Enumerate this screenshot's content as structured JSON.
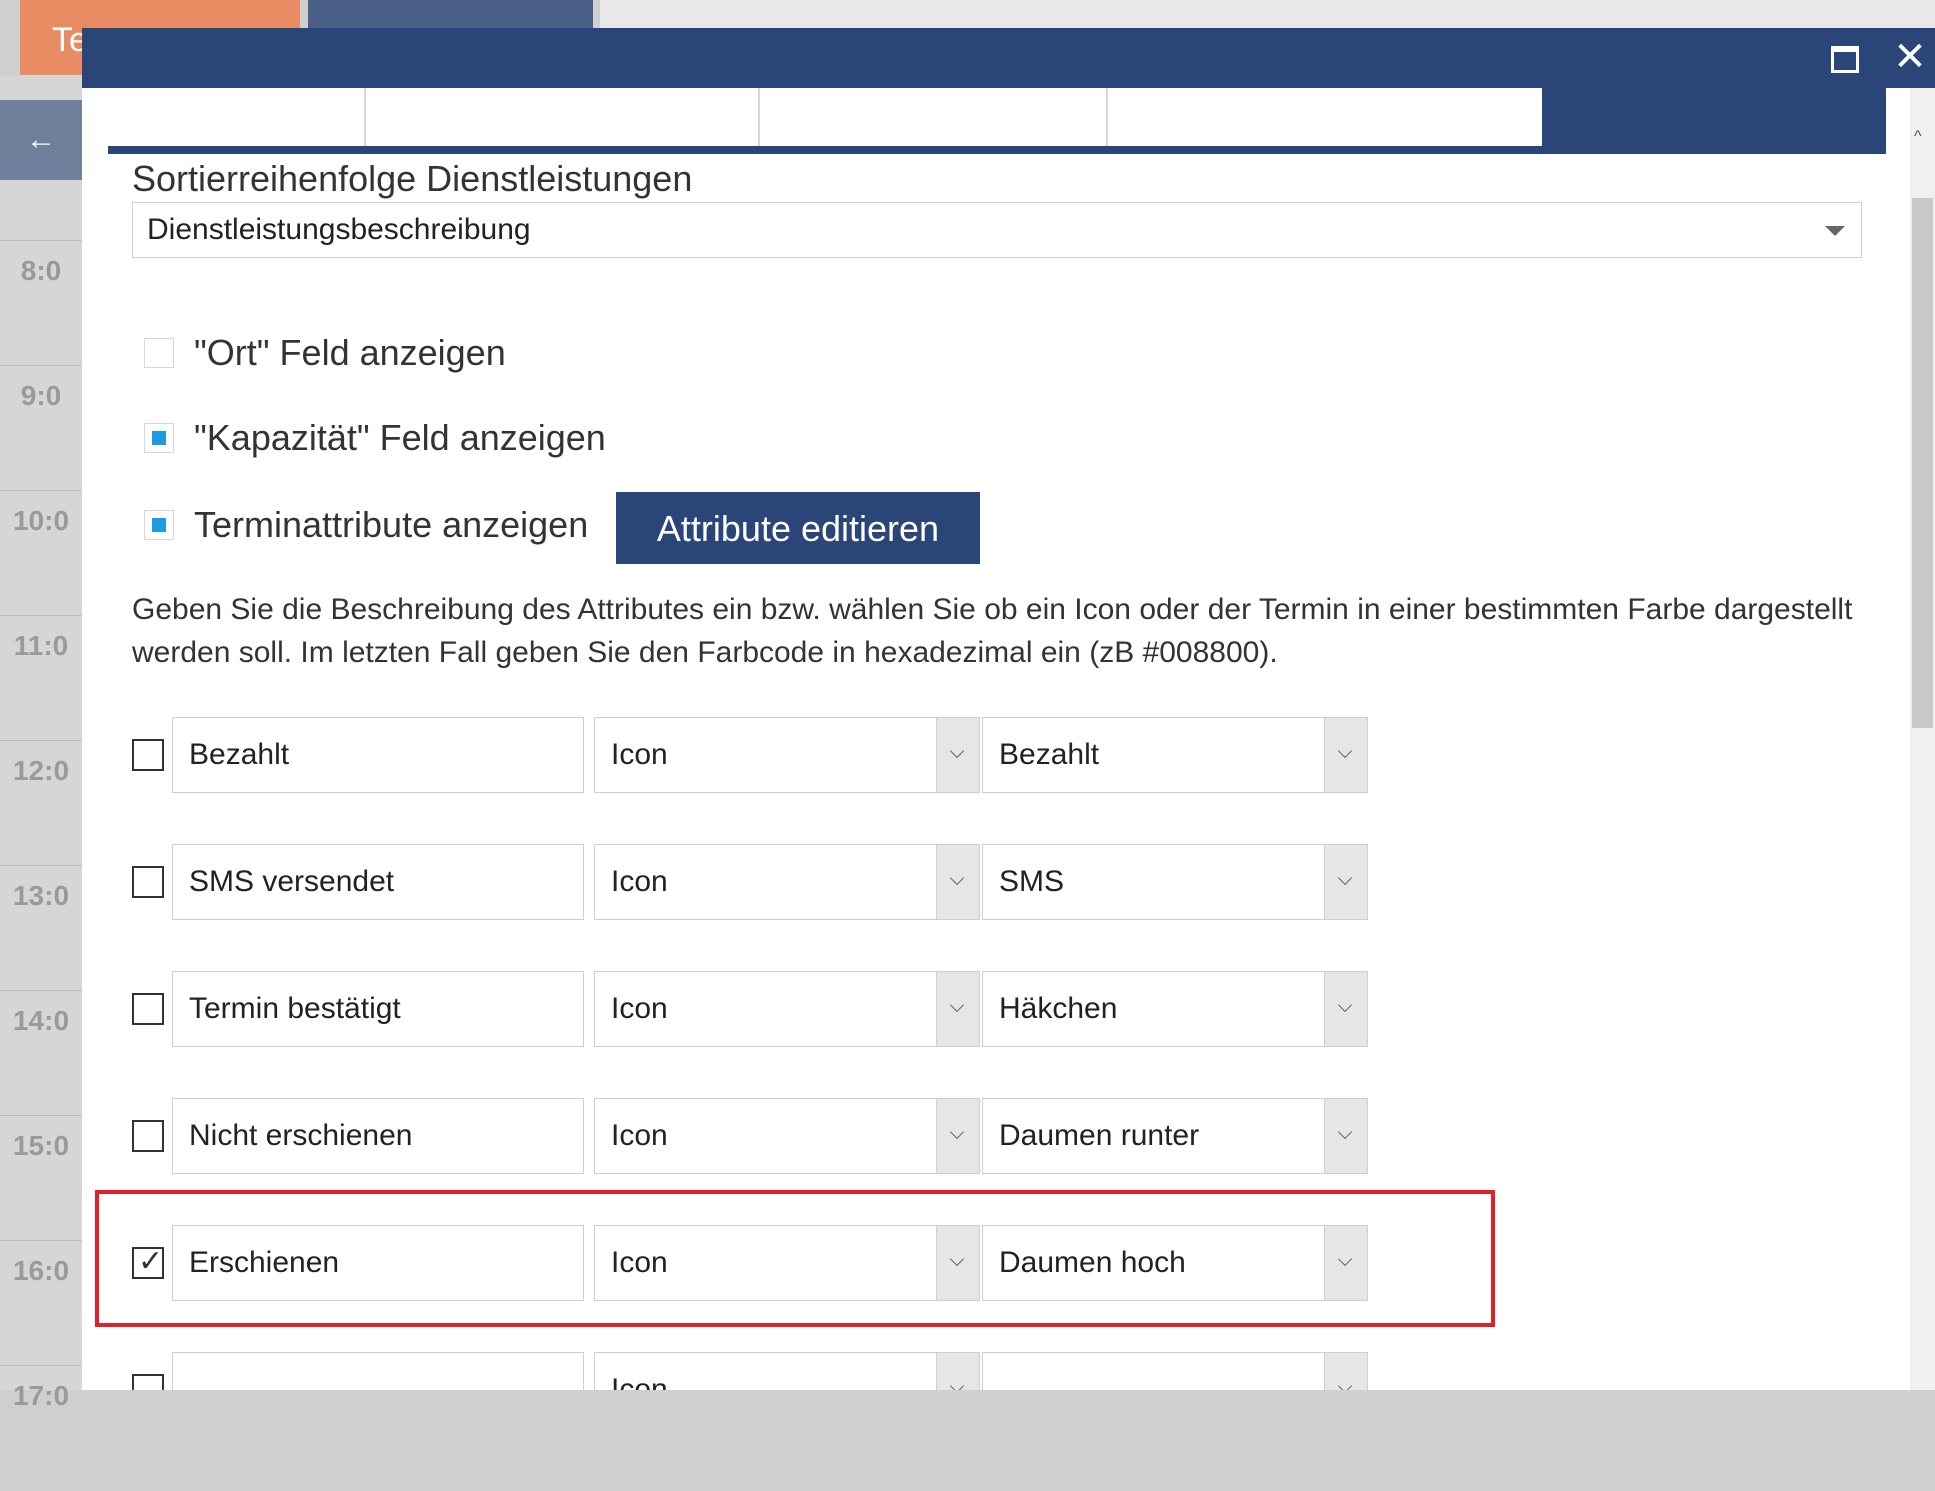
{
  "background": {
    "tab_orange_label": "Te",
    "back_arrow": "←",
    "times": [
      "8:0",
      "9:0",
      "10:0",
      "11:0",
      "12:0",
      "13:0",
      "14:0",
      "15:0",
      "16:0",
      "17:0"
    ]
  },
  "dialog": {
    "maximize_icon": "maximize-icon",
    "close_label": "✕"
  },
  "sort": {
    "label": "Sortierreihenfolge Dienstleistungen",
    "selected": "Dienstleistungsbeschreibung"
  },
  "options": [
    {
      "label": "\"Ort\" Feld anzeigen",
      "checked": false
    },
    {
      "label": "\"Kapazität\" Feld anzeigen",
      "checked": true
    },
    {
      "label": "Terminattribute anzeigen",
      "checked": true
    }
  ],
  "edit_button_label": "Attribute editieren",
  "description": "Geben Sie die Beschreibung des Attributes ein bzw. wählen Sie ob ein Icon oder der Termin in einer bestimmten Farbe dargestellt werden soll. Im letzten Fall geben Sie den Farbcode in hexadezimal ein (zB #008800).",
  "attributes": [
    {
      "name": "Bezahlt",
      "type": "Icon",
      "value": "Bezahlt",
      "checked": false
    },
    {
      "name": "SMS versendet",
      "type": "Icon",
      "value": "SMS",
      "checked": false
    },
    {
      "name": "Termin bestätigt",
      "type": "Icon",
      "value": "Häkchen",
      "checked": false
    },
    {
      "name": "Nicht erschienen",
      "type": "Icon",
      "value": "Daumen runter",
      "checked": false
    },
    {
      "name": "Erschienen",
      "type": "Icon",
      "value": "Daumen hoch",
      "checked": true
    },
    {
      "name": "",
      "type": "Icon",
      "value": "",
      "checked": false
    }
  ],
  "colors": {
    "header": "#2a4578",
    "accent_checkbox": "#1e9be0",
    "highlight": "#e0202a",
    "tab_orange": "#e98b63"
  }
}
